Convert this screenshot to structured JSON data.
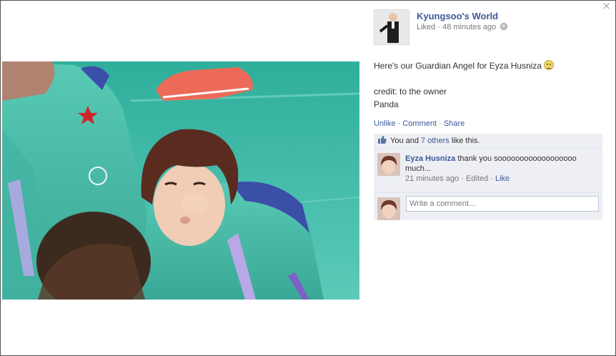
{
  "dialog": {
    "close_label": "×"
  },
  "post": {
    "page_name": "Kyungsoo's World",
    "meta_liked": "Liked",
    "meta_sep": " · ",
    "meta_time": "48 minutes ago",
    "caption": {
      "line1": "Here's our Guardian Angel for Eyza Husniza",
      "line2": "credit: to the owner",
      "line3": "Panda"
    },
    "actions": {
      "unlike": "Unlike",
      "comment": "Comment",
      "share": "Share",
      "sep": " · "
    },
    "likes": {
      "prefix": "You and ",
      "others_link": "7 others",
      "suffix": " like this."
    },
    "comments": [
      {
        "author": "Eyza Husniza",
        "text": "thank you soooooooooooooooooo much...",
        "time": "21 minutes ago",
        "edited": "Edited",
        "like_label": "Like",
        "sep": " · "
      }
    ],
    "reply_placeholder": "Write a comment..."
  },
  "icons": [
    "close-icon",
    "globe-icon",
    "smiley-icon",
    "thumbs-up-icon"
  ],
  "colors": {
    "link": "#3b5998",
    "feedback_bg": "#edeff4",
    "input_border": "#bdc7d8"
  }
}
